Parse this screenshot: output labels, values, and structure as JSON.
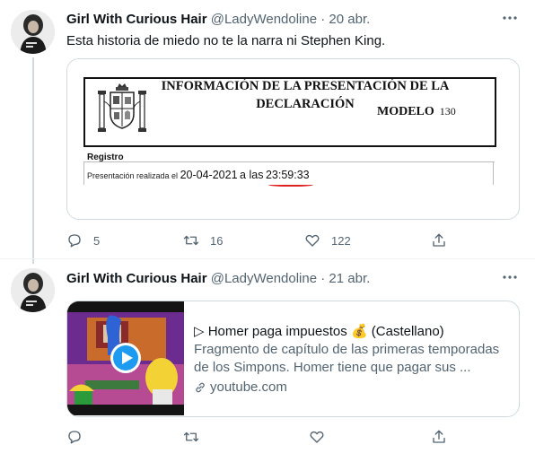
{
  "tweets": [
    {
      "display_name": "Girl With Curious Hair",
      "handle": "@LadyWendoline",
      "separator": "·",
      "date": "20 abr.",
      "text": "Esta historia de miedo no te la narra ni Stephen King.",
      "media": {
        "title_line1": "INFORMACIÓN DE LA PRESENTACIÓN DE LA",
        "title_line2": "DECLARACIÓN",
        "modelo_label": "MODELO",
        "modelo_number": "130",
        "registro_label": "Registro",
        "presentacion_prefix": "Presentación realizada el",
        "presentacion_date": "20-04-2021",
        "presentacion_mid": "a las",
        "presentacion_time": "23:59:33"
      },
      "actions": {
        "replies": "5",
        "retweets": "16",
        "likes": "122"
      }
    },
    {
      "display_name": "Girl With Curious Hair",
      "handle": "@LadyWendoline",
      "separator": "·",
      "date": "21 abr.",
      "card": {
        "title": "▷ Homer paga impuestos 💰 (Castellano)",
        "description": "Fragmento de capítulo de las primeras temporadas de los Simpons. Homer tiene que pagar sus ...",
        "domain": "youtube.com"
      },
      "actions": {
        "replies": "",
        "retweets": "",
        "likes": ""
      }
    }
  ],
  "icons": {
    "more": "more-icon",
    "reply": "reply-icon",
    "retweet": "retweet-icon",
    "like": "heart-icon",
    "share": "share-icon",
    "play": "play-icon",
    "link": "link-icon"
  },
  "colors": {
    "text": "#0f1419",
    "secondary": "#536471",
    "border": "#cfd9de",
    "play_button": "#1d9bf0",
    "underline": "#dd2222"
  }
}
